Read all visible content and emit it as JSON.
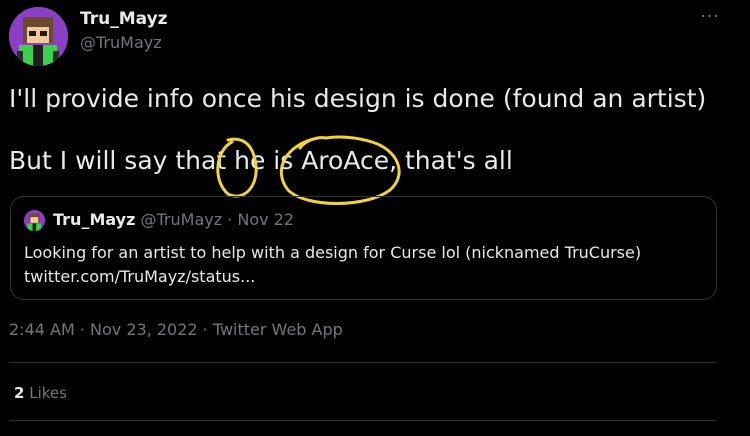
{
  "author": {
    "display_name": "Tru_Mayz",
    "handle": "@TruMayz",
    "avatar_icon": "avatar-icon"
  },
  "more_label": "···",
  "tweet": {
    "line1": "I'll provide info once his design is done (found an artist)",
    "line2": "But I will say that he is AroAce, that's all"
  },
  "annotation": {
    "color": "#f2d33a"
  },
  "quoted": {
    "display_name": "Tru_Mayz",
    "handle": "@TruMayz",
    "separator": "·",
    "date": "Nov 22",
    "text_line1": "Looking for an artist to help with a design for Curse lol (nicknamed TruCurse)",
    "text_line2": "twitter.com/TruMayz/status..."
  },
  "meta": {
    "timestamp": "2:44 AM · Nov 23, 2022 · Twitter Web App"
  },
  "engagement": {
    "likes_count": "2",
    "likes_label": "Likes"
  },
  "colors": {
    "background": "#000000",
    "text": "#e7e9ea",
    "muted": "#71767b",
    "border": "#2f3336",
    "avatar_bg": "#8a3fc4"
  }
}
